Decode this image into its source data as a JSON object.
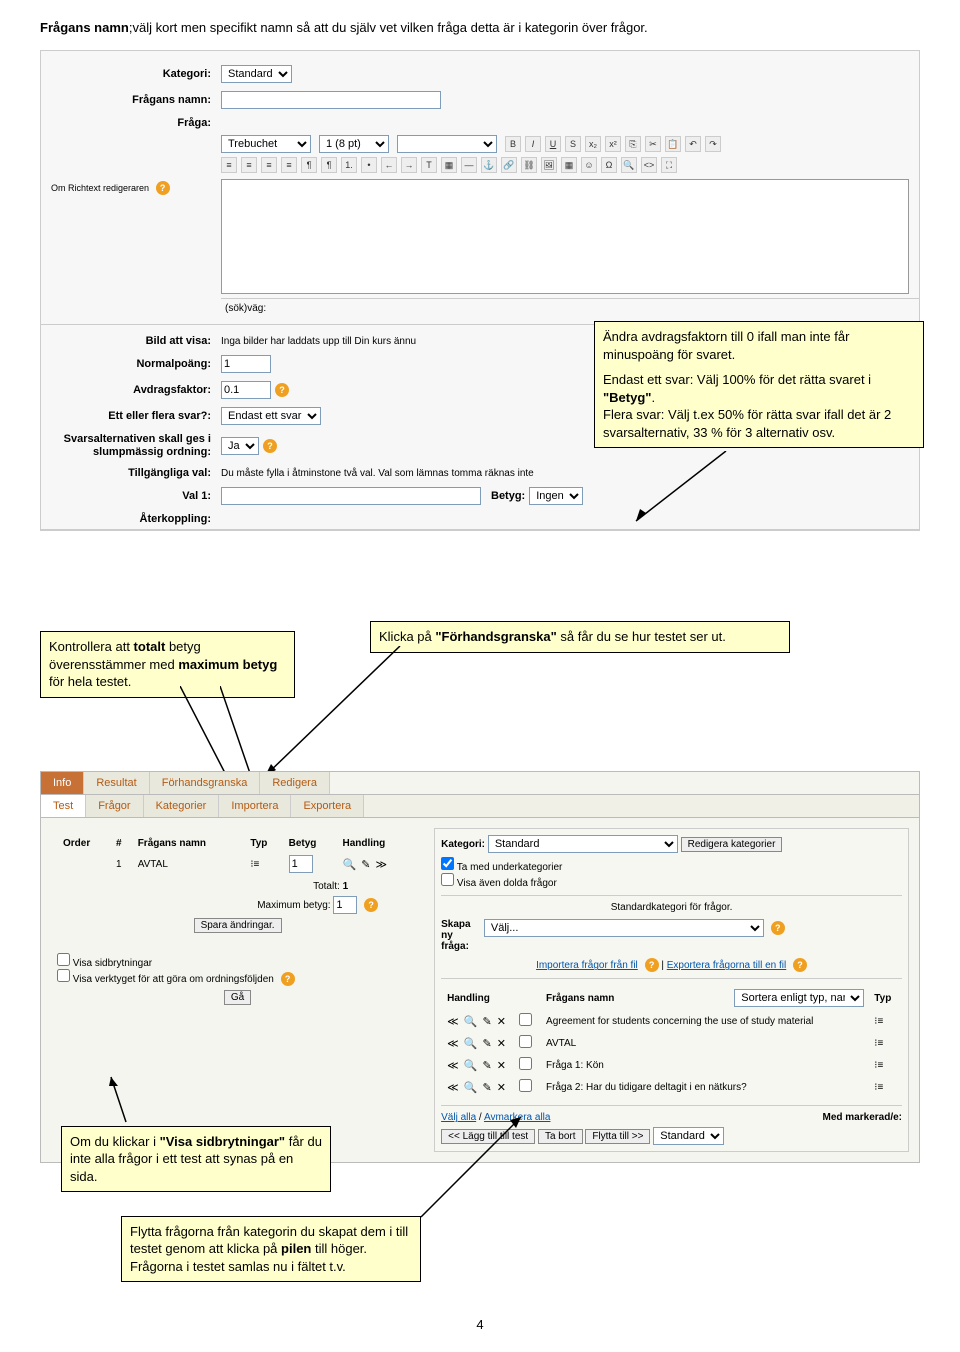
{
  "heading": {
    "bold": "Frågans namn",
    "rest": ";välj kort men specifikt namn så att du själv vet vilken fråga detta är i kategorin över frågor."
  },
  "form": {
    "kategori_label": "Kategori:",
    "kategori_value": "Standard",
    "namn_label": "Frågans namn:",
    "fraga_label": "Fråga:",
    "font_value": "Trebuchet",
    "size_value": "1 (8 pt)",
    "richtext_label": "Om Richtext redigeraren",
    "sokvag_label": "(sök)väg:",
    "bild_label": "Bild att visa:",
    "bild_text": "Inga bilder har laddats upp till Din kurs ännu",
    "normal_label": "Normalpoäng:",
    "normal_value": "1",
    "avdrag_label": "Avdragsfaktor:",
    "avdrag_value": "0.1",
    "flera_label": "Ett eller flera svar?:",
    "flera_value": "Endast ett svar",
    "slump_label": "Svarsalternativen skall ges i slumpmässig ordning:",
    "slump_value": "Ja",
    "tillg_label": "Tillgängliga val:",
    "tillg_text": "Du måste fylla i åtminstone två val. Val som lämnas tomma räknas inte",
    "val1_label": "Val 1:",
    "betyg_label": "Betyg:",
    "betyg_value": "Ingen",
    "ater_label": "Återkoppling:"
  },
  "callout1": {
    "p1": "Ändra avdragsfaktorn till 0 ifall man inte får minuspoäng för svaret.",
    "p2a": "Endast ett svar: Välj 100% för det rätta svaret i ",
    "p2b": "\"Betyg\"",
    "p2c": ".",
    "p3": "Flera svar: Välj t.ex 50% för rätta svar ifall det är 2 svarsalternativ, 33 % för 3 alternativ osv."
  },
  "callout2": {
    "t1": "Kontrollera att ",
    "b1": "totalt",
    "t2": " betyg överensstämmer med ",
    "b2": "maximum betyg",
    "t3": " för hela testet."
  },
  "callout3": {
    "t1": "Klicka på ",
    "b1": "\"Förhandsgranska\"",
    "t2": " så får du se hur testet ser ut."
  },
  "callout4": {
    "t1": "Om du klickar i ",
    "b1": "\"Visa sidbrytningar\"",
    "t2": " får du inte alla frågor i ett test att synas på en sida."
  },
  "callout5": {
    "t1": "Flytta frågorna från kategorin du skapat dem i till testet genom att klicka på ",
    "b1": "pilen",
    "t2": " till höger. Frågorna i testet samlas nu i fältet t.v."
  },
  "tabs": {
    "row1": [
      "Info",
      "Resultat",
      "Förhandsgranska",
      "Redigera"
    ],
    "row2": [
      "Test",
      "Frågor",
      "Kategorier",
      "Importera",
      "Exportera"
    ]
  },
  "leftpane": {
    "headers": {
      "order": "Order",
      "num": "#",
      "name": "Frågans namn",
      "typ": "Typ",
      "betyg": "Betyg",
      "handling": "Handling"
    },
    "row_num": "1",
    "row_name": "AVTAL",
    "row_betyg": "1",
    "totalt_label": "Totalt:",
    "totalt_value": "1",
    "max_label": "Maximum betyg:",
    "max_value": "1",
    "save_btn": "Spara ändringar.",
    "visa_sid": "Visa sidbrytningar",
    "visa_verk": "Visa verktyget för att göra om ordningsföljden",
    "go_btn": "Gå"
  },
  "rightpane": {
    "kategori_label": "Kategori:",
    "kategori_value": "Standard",
    "edit_btn": "Redigera kategorier",
    "cb1": "Ta med underkategorier",
    "cb2": "Visa även dolda frågor",
    "stdcat": "Standardkategori för frågor.",
    "skapa_label": "Skapa ny fråga:",
    "skapa_value": "Välj...",
    "import_link": "Importera frågor från fil",
    "export_link": "Exportera frågorna till en fil",
    "th_handling": "Handling",
    "th_name": "Frågans namn",
    "th_typ": "Typ",
    "sort_value": "Sortera enligt typ, namn",
    "q1": "Agreement for students concerning the use of study material",
    "q2": "AVTAL",
    "q3": "Fråga 1: Kön",
    "q4": "Fråga 2: Har du tidigare deltagit i en nätkurs?",
    "sel_all": "Välj alla",
    "desel_all": "Avmarkera alla",
    "marked": "Med markerad/e:",
    "b_add": "<< Lägg till till test",
    "b_del": "Ta bort",
    "b_move": "Flytta till >>",
    "move_value": "Standard"
  },
  "pagenum": "4"
}
